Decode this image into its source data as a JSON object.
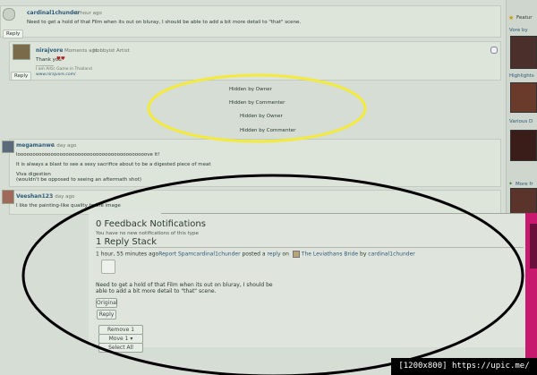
{
  "comments": [
    {
      "user": "cardinal1chunder",
      "time": "1 hour ago",
      "text": "Need to get a hold of that Film when its out on bluray, I should be able to add a bit more detail to \"that\" scene.",
      "reply": "Reply"
    },
    {
      "user": "nirajvore",
      "time": "Moments ago",
      "role": "Hobbyist Artist",
      "text": "Thank you",
      "hearts": "♥♥",
      "sig1": "I am Artic Game in Thailand",
      "sig2": "www.nirajvore.com/",
      "reply": "Reply"
    },
    {
      "user": "megamanwe",
      "time": "1 day ago",
      "text1": "looooooooooooooooooooooooooooooooooooooooooove it!",
      "text2": "It is always a blast to see a sexy sacrifice about to be a digested piece of meat",
      "text3": "Viva digestion",
      "text4": "(wouldn't be opposed to seeing an aftermath shot)"
    },
    {
      "user": "Veeshan123",
      "time": "1 day ago",
      "text": "I like the painting-like quality to the image"
    }
  ],
  "hidden": [
    "Hidden by Owner",
    "Hidden by Commenter",
    "Hidden by Owner",
    "Hidden by Commenter"
  ],
  "sidebar": {
    "featured": "Featur",
    "vore_by": "Vore by",
    "highlights": "Highlights",
    "various": "Various D",
    "more_from": "More fr"
  },
  "notifications": {
    "feedback_title": "0 Feedback Notifications",
    "feedback_sub": "You have no new notifications of this type",
    "reply_stack": "1 Reply Stack",
    "meta_time": "1 hour, 55 minutes ago",
    "meta_report": "Report Spam",
    "meta_user": "cardinal1chunder",
    "meta_posted": " posted a ",
    "meta_reply": "reply",
    "meta_on": " on ",
    "meta_deviation": "The Leviathans Bride",
    "meta_by": " by ",
    "meta_author": "cardinal1chunder",
    "body1": "Need to get a hold of that Film when its out on bluray, I should be",
    "body2": "able to add a bit more detail to \"that\" scene.",
    "original": "Original",
    "reply": "Reply",
    "remove": "Remove 1",
    "move": "Move 1 ▾",
    "select_all": "Select All"
  },
  "watermark": "[1200x800] https://upic.me/",
  "colors": {
    "accent": "#2e5a7a",
    "highlight_ring": "#f3ea3c",
    "ring": "#000000",
    "pink": "#c7196e"
  }
}
